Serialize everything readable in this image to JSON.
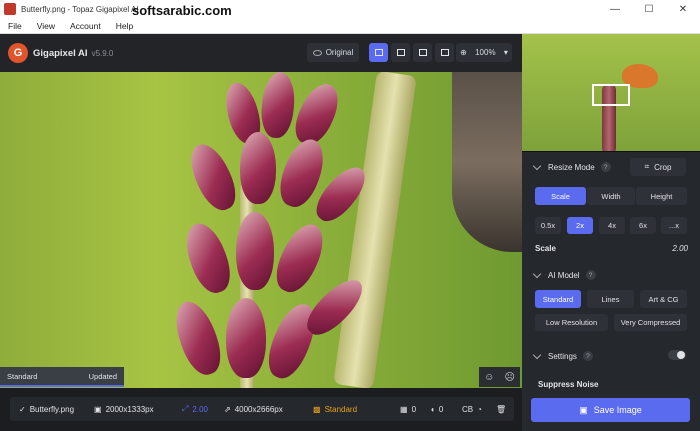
{
  "window": {
    "title": "Butterfly.png - Topaz Gigapixel AI",
    "watermark": "softsarabic.com",
    "controls": [
      "—",
      "☐",
      "✕"
    ]
  },
  "menu": [
    "File",
    "View",
    "Account",
    "Help"
  ],
  "topbar": {
    "brand": "Gigapixel AI",
    "version": "v5.9.0",
    "original_label": "Original",
    "zoom": "100%"
  },
  "canvas": {
    "status_left": "Standard",
    "status_right": "Updated"
  },
  "filebar": {
    "filename": "Butterfly.png",
    "src_size": "2000x1333px",
    "scale": "2.00",
    "out_size": "4000x2666px",
    "model": "Standard",
    "count": "0",
    "volume": "0",
    "cb": "CB"
  },
  "side": {
    "resize_mode": "Resize Mode",
    "crop": "Crop",
    "tabs": [
      "Scale",
      "Width",
      "Height"
    ],
    "scales": [
      "0.5x",
      "2x",
      "4x",
      "6x",
      "...x"
    ],
    "scale_label": "Scale",
    "scale_value": "2.00",
    "ai_model": "AI Model",
    "models_row1": [
      "Standard",
      "Lines",
      "Art & CG"
    ],
    "models_row2": [
      "Low Resolution",
      "Very Compressed"
    ],
    "settings": "Settings",
    "suppress": "Suppress Noise",
    "save": "Save Image"
  },
  "colors": {
    "accent": "#5a6bf0",
    "model_badge": "#e6a018",
    "logo": "#e0552b"
  }
}
